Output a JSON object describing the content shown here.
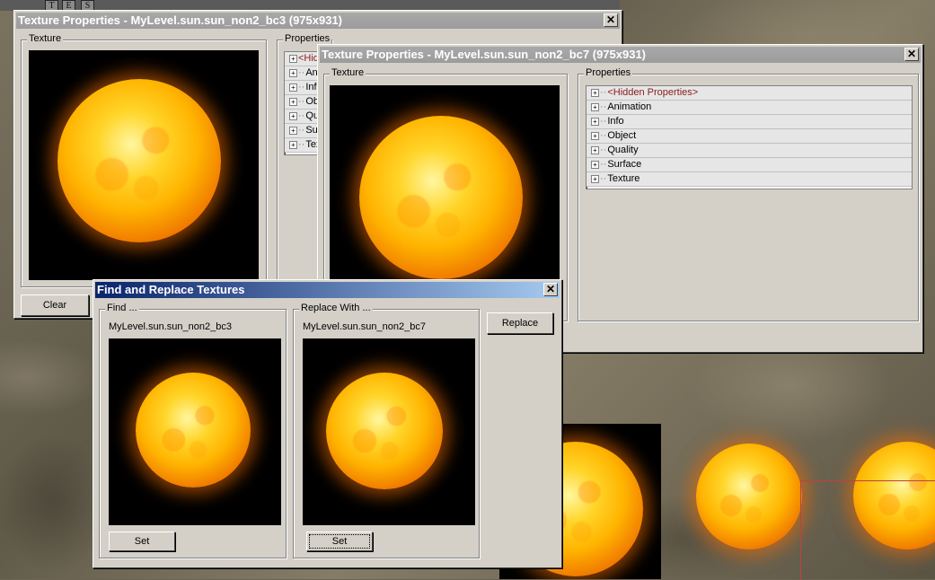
{
  "toolbar": {
    "buttons": [
      "T",
      "E",
      "S"
    ]
  },
  "window_bc3": {
    "title": "Texture Properties - MyLevel.sun.sun_non2_bc3 (975x931)",
    "close": "✕",
    "texture_group": "Texture",
    "properties_group": "Properties",
    "clear_button": "Clear",
    "tree": [
      "<Hidd",
      "Ani",
      "Info",
      "Obj",
      "Qua",
      "Sur",
      "Tex"
    ]
  },
  "window_bc7": {
    "title": "Texture Properties - MyLevel.sun.sun_non2_bc7 (975x931)",
    "close": "✕",
    "texture_group": "Texture",
    "properties_group": "Properties",
    "tree": [
      "<Hidden Properties>",
      "Animation",
      "Info",
      "Object",
      "Quality",
      "Surface",
      "Texture"
    ]
  },
  "find_replace": {
    "title": "Find and Replace Textures",
    "close": "✕",
    "find_group": "Find ...",
    "find_texture": "MyLevel.sun.sun_non2_bc3",
    "replace_group": "Replace With ...",
    "replace_texture": "MyLevel.sun.sun_non2_bc7",
    "set_button": "Set",
    "replace_button": "Replace"
  },
  "colors": {
    "titlebar_active": "#0a246a",
    "titlebar_inactive": "#a0a0a0",
    "dialog_face": "#d4d0c8",
    "hidden_props": "#8b1a1a"
  }
}
